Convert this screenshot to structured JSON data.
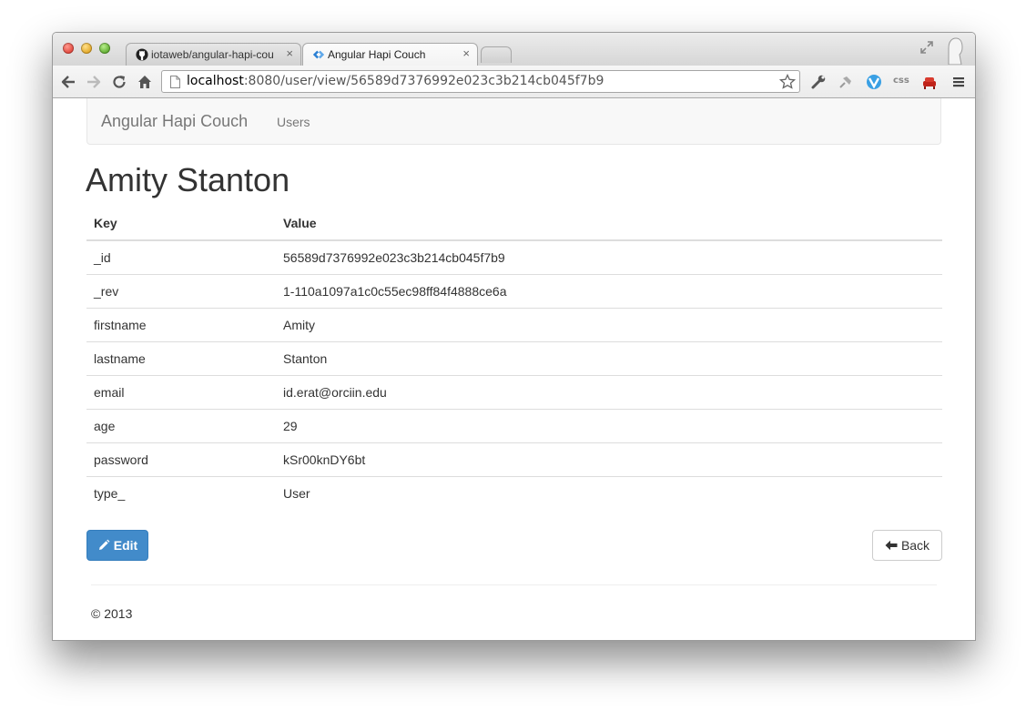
{
  "browser": {
    "tabs": [
      {
        "title": "iotaweb/angular-hapi-cou",
        "active": false,
        "icon": "github-icon"
      },
      {
        "title": "Angular Hapi Couch",
        "active": true,
        "icon": "angular-icon"
      }
    ],
    "close_glyph": "×",
    "address": {
      "host": "localhost",
      "path": ":8080/user/view/56589d7376992e023c3b214cb045f7b9"
    },
    "extensions": {
      "css_label": "css"
    }
  },
  "navbar": {
    "brand": "Angular Hapi Couch",
    "links": [
      {
        "label": "Users"
      }
    ]
  },
  "page": {
    "title": "Amity Stanton"
  },
  "table": {
    "headers": [
      "Key",
      "Value"
    ],
    "rows": [
      {
        "key": "_id",
        "value": "56589d7376992e023c3b214cb045f7b9"
      },
      {
        "key": "_rev",
        "value": "1-110a1097a1c0c55ec98ff84f4888ce6a"
      },
      {
        "key": "firstname",
        "value": "Amity"
      },
      {
        "key": "lastname",
        "value": "Stanton"
      },
      {
        "key": "email",
        "value": "id.erat@orciin.edu"
      },
      {
        "key": "age",
        "value": "29"
      },
      {
        "key": "password",
        "value": "kSr00knDY6bt"
      },
      {
        "key": "type_",
        "value": "User"
      }
    ]
  },
  "actions": {
    "edit_label": "Edit",
    "back_label": "Back"
  },
  "footer": {
    "text": "© 2013"
  },
  "colors": {
    "primary": "#428bca",
    "text": "#333333",
    "muted": "#777777"
  }
}
